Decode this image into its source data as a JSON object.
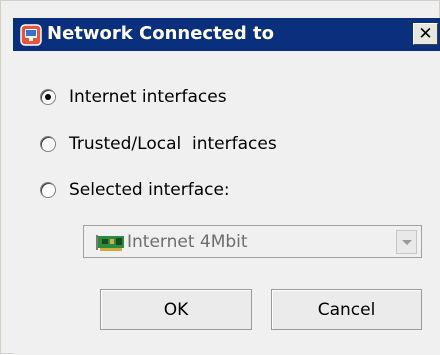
{
  "window": {
    "title": "Network Connected to",
    "close_label": "✕",
    "icon": "app-network-icon"
  },
  "options": [
    {
      "label": "Internet interfaces",
      "checked": true
    },
    {
      "label": "Trusted/Local  interfaces",
      "checked": false
    },
    {
      "label": "Selected interface:",
      "checked": false
    }
  ],
  "interface_select": {
    "value": "Internet 4Mbit",
    "icon": "network-card-icon",
    "disabled": true
  },
  "buttons": {
    "ok": "OK",
    "cancel": "Cancel"
  }
}
